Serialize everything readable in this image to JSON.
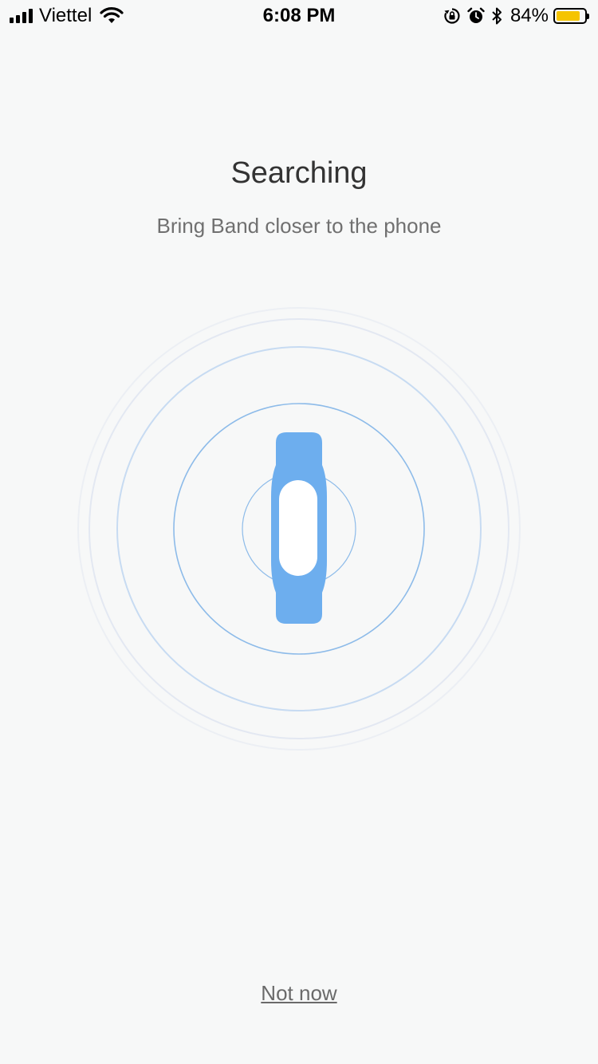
{
  "status_bar": {
    "carrier": "Viettel",
    "time": "6:08 PM",
    "battery_percent": "84%",
    "battery_level": 0.84,
    "battery_color": "#f5c400",
    "icons": [
      "signal-icon",
      "wifi-icon",
      "rotation-lock-icon",
      "alarm-icon",
      "bluetooth-icon",
      "battery-icon"
    ]
  },
  "main": {
    "title": "Searching",
    "subtitle": "Bring Band closer to the phone",
    "illustration": {
      "icon": "fitness-band-icon",
      "band_color": "#6daeee",
      "ring_color": "#a9c9ee"
    }
  },
  "footer": {
    "not_now_label": "Not now"
  }
}
